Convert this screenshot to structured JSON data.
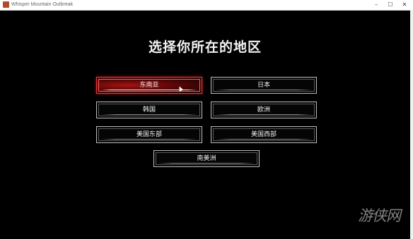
{
  "window": {
    "title": "Whisper Mountain Outbreak",
    "controls": {
      "minimize": "–",
      "maximize": "☐",
      "close": "✕"
    }
  },
  "screen": {
    "heading": "选择你所在的地区",
    "regions": [
      {
        "label": "东南亚",
        "selected": true
      },
      {
        "label": "日本",
        "selected": false
      },
      {
        "label": "韩国",
        "selected": false
      },
      {
        "label": "欧洲",
        "selected": false
      },
      {
        "label": "美国东部",
        "selected": false
      },
      {
        "label": "美国西部",
        "selected": false
      },
      {
        "label": "南美洲",
        "selected": false
      }
    ]
  },
  "watermark": "游侠网",
  "colors": {
    "background": "#000000",
    "selected_fill": "#7a0a0a",
    "selected_border": "#e04040",
    "button_border": "#bdbdbd"
  }
}
